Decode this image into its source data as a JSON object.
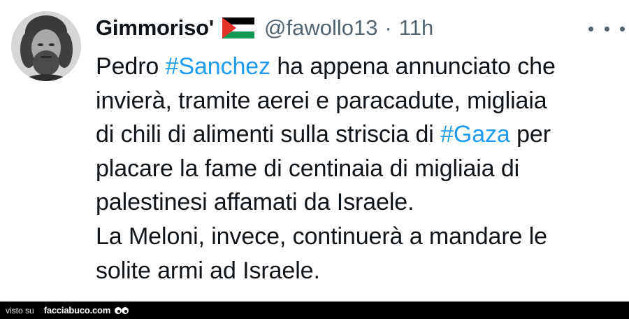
{
  "tweet": {
    "author": {
      "display_name": "Gimmoriso'",
      "flag_icon": "palestine-flag-icon",
      "handle": "@fawollo13",
      "separator": "·",
      "time": "11h"
    },
    "more_icon": "more-horizontal-icon",
    "lines": [
      [
        {
          "t": "Pedro "
        },
        {
          "t": "#Sanchez",
          "tag": true
        },
        {
          "t": " ha appena annunciato che"
        }
      ],
      [
        {
          "t": "invierà, tramite aerei e paracadute, migliaia"
        }
      ],
      [
        {
          "t": "di chili di alimenti sulla striscia di "
        },
        {
          "t": "#Gaza",
          "tag": true
        },
        {
          "t": " per"
        }
      ],
      [
        {
          "t": "placare la fame di centinaia di migliaia di"
        }
      ],
      [
        {
          "t": "palestinesi affamati da Israele."
        }
      ],
      [
        {
          "t": "La Meloni, invece, continuerà a mandare le"
        }
      ],
      [
        {
          "t": "solite armi ad Israele."
        }
      ]
    ]
  },
  "colors": {
    "text": "#0f1419",
    "secondary": "#536471",
    "hashtag": "#1d9bf0",
    "flag_black": "#000000",
    "flag_green": "#149954",
    "flag_red": "#e4312b",
    "footer_bg": "#000000"
  },
  "footer": {
    "prefix": "visto su",
    "site": "facciabuco.com",
    "logo_icon": "eyes-logo-icon"
  }
}
